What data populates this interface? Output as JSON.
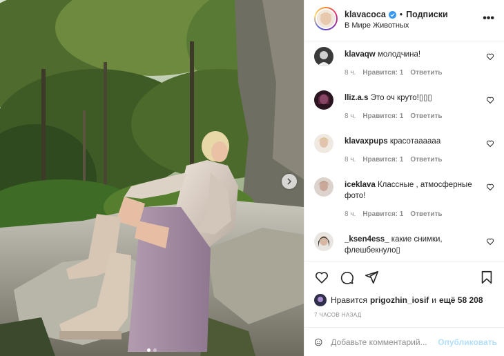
{
  "post": {
    "author": "klavacoca",
    "separator": "•",
    "follow_label": "Подписки",
    "location": "В Мире Животных",
    "more_label": "•••"
  },
  "comments": [
    {
      "user": "klavaqw",
      "text": "молодчина!",
      "time": "8 ч.",
      "likes": "Нравится: 1",
      "reply": "Ответить",
      "avatar_color": "#3a3a3a"
    },
    {
      "user": "lliz.a.s",
      "text": "Это оч круто!▯▯▯",
      "time": "8 ч.",
      "likes": "Нравится: 1",
      "reply": "Ответить",
      "avatar_color": "#6b2a4a"
    },
    {
      "user": "klavaxpups",
      "text": "красотаааааа",
      "time": "8 ч.",
      "likes": "Нравится: 1",
      "reply": "Ответить",
      "avatar_color": "#d9cfc4"
    },
    {
      "user": "iceklava",
      "text": "Классные , атмосферные фото!",
      "time": "8 ч.",
      "likes": "Нравится: 1",
      "reply": "Ответить",
      "avatar_color": "#c9a89a"
    },
    {
      "user": "_ksen4ess_",
      "text": "какие снимки, флешбекнуло▯",
      "time": "",
      "likes": "",
      "reply": "",
      "avatar_color": "#2b2b2b"
    }
  ],
  "likes": {
    "prefix": "Нравится",
    "user": "prigozhin_iosif",
    "middle": "и",
    "count": "ещё 58 208"
  },
  "timestamp": "7 ЧАСОВ НАЗАД",
  "add_comment": {
    "placeholder": "Добавьте комментарий...",
    "publish_label": "Опубликовать"
  },
  "icons": {
    "next": "chevron-right-icon",
    "heart": "heart-icon",
    "comment": "comment-icon",
    "share": "share-icon",
    "save": "bookmark-icon",
    "emoji": "emoji-icon",
    "verified": "verified-badge-icon"
  },
  "colors": {
    "verified": "#3897f0",
    "publish_disabled": "#b2dffc",
    "muted": "#8e8e8e"
  }
}
